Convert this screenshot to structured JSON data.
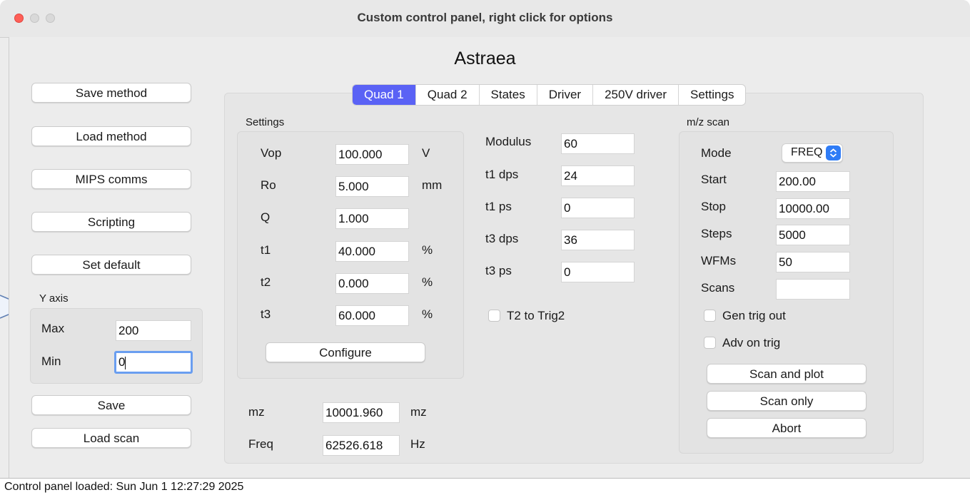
{
  "window": {
    "title": "Custom control panel, right click for options",
    "traffic_lights": {
      "close": "#fe5f57",
      "minimize": "#d9d9d9",
      "maximize": "#d9d9d9"
    }
  },
  "panel_title": "Astraea",
  "left": {
    "buttons": [
      "Save method",
      "Load method",
      "MIPS comms",
      "Scripting",
      "Set default"
    ],
    "yaxis": {
      "label": "Y axis",
      "max_label": "Max",
      "max_value": "200",
      "min_label": "Min",
      "min_value": "0"
    },
    "save_label": "Save",
    "load_scan_label": "Load scan"
  },
  "tabs": [
    "Quad 1",
    "Quad 2",
    "States",
    "Driver",
    "250V driver",
    "Settings"
  ],
  "active_tab": "Quad 1",
  "settings": {
    "group_label": "Settings",
    "rows": [
      {
        "label": "Vop",
        "value": "100.000",
        "unit": "V"
      },
      {
        "label": "Ro",
        "value": "5.000",
        "unit": "mm"
      },
      {
        "label": "Q",
        "value": "1.000",
        "unit": ""
      },
      {
        "label": "t1",
        "value": "40.000",
        "unit": "%"
      },
      {
        "label": "t2",
        "value": "0.000",
        "unit": "%"
      },
      {
        "label": "t3",
        "value": "60.000",
        "unit": "%"
      }
    ],
    "configure_label": "Configure"
  },
  "mid": {
    "rows": [
      {
        "label": "Modulus",
        "value": "60"
      },
      {
        "label": "t1 dps",
        "value": "24"
      },
      {
        "label": "t1 ps",
        "value": "0"
      },
      {
        "label": "t3 dps",
        "value": "36"
      },
      {
        "label": "t3 ps",
        "value": "0"
      }
    ],
    "t2_to_trig2": "T2 to Trig2"
  },
  "bottom": {
    "mz_label": "mz",
    "mz_value": "10001.960",
    "mz_unit": "mz",
    "freq_label": "Freq",
    "freq_value": "62526.618",
    "freq_unit": "Hz"
  },
  "mzscan": {
    "group_label": "m/z scan",
    "mode_label": "Mode",
    "mode_value": "FREQ",
    "rows": [
      {
        "label": "Start",
        "value": "200.00"
      },
      {
        "label": "Stop",
        "value": "10000.00"
      },
      {
        "label": "Steps",
        "value": "5000"
      },
      {
        "label": "WFMs",
        "value": "50"
      },
      {
        "label": "Scans",
        "value": ""
      }
    ],
    "gen_trig_out": "Gen trig out",
    "adv_on_trig": "Adv on trig",
    "scan_and_plot": "Scan and plot",
    "scan_only": "Scan only",
    "abort": "Abort"
  },
  "status": "Control panel loaded: Sun Jun 1 12:27:29 2025",
  "colors": {
    "accent": "#5a62f5",
    "focus": "#6a9ef0",
    "close": "#fe5f57"
  }
}
